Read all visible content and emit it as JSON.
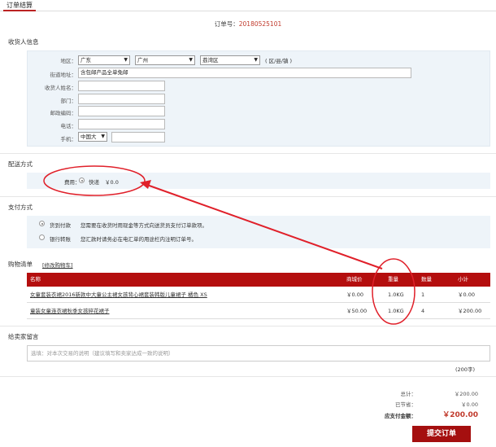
{
  "tab": {
    "label": "订单结算"
  },
  "order": {
    "label": "订单号：",
    "number": "20180525101"
  },
  "receiver": {
    "title": "收货人信息",
    "region_label": "地区：",
    "province": "广东",
    "city": "广州",
    "district": "荔湾区",
    "region_suffix": "( 区/县/镇 )",
    "street_label": "街道地址：",
    "street_value": "含包邮产品全单免邮",
    "name_label": "收货人姓名：",
    "dept_label": "部门：",
    "zip_label": "邮政编码：",
    "phone_label": "电话：",
    "mobile_label": "手机：",
    "mobile_country": "中国大"
  },
  "shipping": {
    "title": "配送方式",
    "fee_label": "费用：",
    "option": "快递",
    "price": "￥0.0"
  },
  "payment": {
    "title": "支付方式",
    "options": [
      {
        "name": "货到付款",
        "desc": "您需要在收货时用现金等方式向送货员支付订单款项。"
      },
      {
        "name": "银行转账",
        "desc": "您汇款时请务必在电汇单的用途栏内注明订单号。"
      }
    ]
  },
  "cart": {
    "title": "购物清单",
    "back_link": "[修改购物车]",
    "headers": {
      "name": "名称",
      "price": "商城价",
      "weight": "重量",
      "qty": "数量",
      "subtotal": "小计"
    },
    "rows": [
      {
        "name": "女童套装衣裙2016新款中大童公主裙女孩背心裙套装韩版儿童裙子 橘色 XS",
        "price": "￥0.00",
        "weight": "1.0KG",
        "qty": "1",
        "subtotal": "￥0.00"
      },
      {
        "name": "童装女童连衣裙秋季女孩碎花裙子",
        "price": "￥50.00",
        "weight": "1.0KG",
        "qty": "4",
        "subtotal": "￥200.00"
      }
    ]
  },
  "message": {
    "title": "给卖家留言",
    "placeholder": "选填：对本次交易的说明（建议填写和卖家达成一致的说明）",
    "limit": "(200字)"
  },
  "summary": {
    "total_label": "总计：",
    "total_value": "￥200.00",
    "saved_label": "已节省：",
    "saved_value": "￥0.00",
    "pay_label": "应支付金额：",
    "pay_value": "￥200.00"
  },
  "submit_label": "提交订单",
  "colors": {
    "accent": "#b40e0e",
    "annotation": "#e0202a",
    "panel": "#eef4f9"
  },
  "icons": {
    "dropdown": "chevron-down-icon",
    "radio": "radio-icon"
  }
}
